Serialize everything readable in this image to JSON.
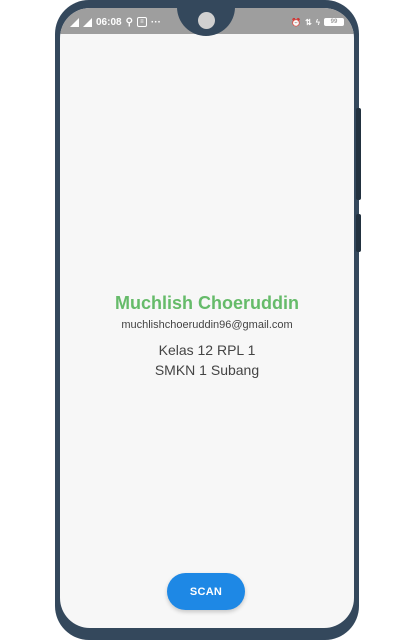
{
  "status_bar": {
    "time": "06:08",
    "left_extra": "···",
    "battery": "99"
  },
  "profile": {
    "name": "Muchlish Choeruddin",
    "email": "muchlishchoeruddin96@gmail.com",
    "class": "Kelas 12 RPL 1",
    "school": "SMKN 1 Subang"
  },
  "actions": {
    "scan_label": "SCAN"
  },
  "colors": {
    "name_green": "#66bb6a",
    "button_blue": "#1e88e5",
    "frame": "#34485c",
    "status_bar": "#9e9e9e"
  }
}
